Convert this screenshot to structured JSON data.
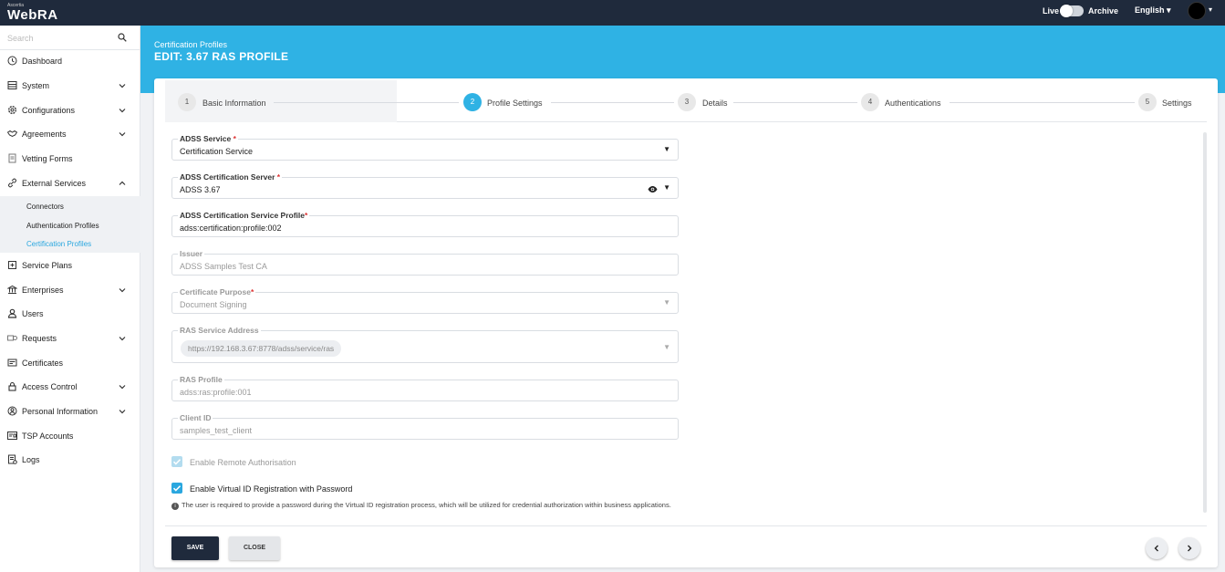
{
  "topbar": {
    "logo_small": "Ascertia",
    "logo_main": "WebRA",
    "live_label": "Live",
    "archive_label": "Archive",
    "language": "English ▾",
    "avatar_caret": "▾"
  },
  "sidebar": {
    "search_placeholder": "Search",
    "items": [
      {
        "label": "Dashboard",
        "icon": "clock-icon"
      },
      {
        "label": "System",
        "icon": "server-icon"
      },
      {
        "label": "Configurations",
        "icon": "gear-icon"
      },
      {
        "label": "Agreements",
        "icon": "handshake-icon"
      },
      {
        "label": "Vetting Forms",
        "icon": "form-icon"
      },
      {
        "label": "External Services",
        "icon": "link-icon"
      },
      {
        "label": "Service Plans",
        "icon": "plan-icon"
      },
      {
        "label": "Enterprises",
        "icon": "bank-icon"
      },
      {
        "label": "Users",
        "icon": "user-icon"
      },
      {
        "label": "Requests",
        "icon": "requests-icon"
      },
      {
        "label": "Certificates",
        "icon": "certificate-icon"
      },
      {
        "label": "Access Control",
        "icon": "lock-icon"
      },
      {
        "label": "Personal Information",
        "icon": "person-circle-icon"
      },
      {
        "label": "TSP Accounts",
        "icon": "id-card-icon"
      },
      {
        "label": "Logs",
        "icon": "logs-icon"
      }
    ],
    "sub_items": [
      {
        "label": "Connectors"
      },
      {
        "label": "Authentication Profiles"
      },
      {
        "label": "Certification Profiles"
      }
    ]
  },
  "header": {
    "breadcrumb": "Certification Profiles",
    "title": "EDIT: 3.67 RAS PROFILE"
  },
  "stepper": [
    {
      "num": "1",
      "label": "Basic Information"
    },
    {
      "num": "2",
      "label": "Profile Settings"
    },
    {
      "num": "3",
      "label": "Details"
    },
    {
      "num": "4",
      "label": "Authentications"
    },
    {
      "num": "5",
      "label": "Settings"
    }
  ],
  "form": {
    "adss_service": {
      "label": "ADSS Service",
      "req": "*",
      "value": "Certification Service"
    },
    "adss_server": {
      "label": "ADSS Certification Server",
      "req": "*",
      "value": "ADSS 3.67"
    },
    "service_profile": {
      "label": "ADSS Certification Service Profile",
      "req": "*",
      "value": "adss:certification:profile:002"
    },
    "issuer": {
      "label": "Issuer",
      "value": "ADSS Samples Test CA"
    },
    "purpose": {
      "label": "Certificate Purpose",
      "req": "*",
      "value": "Document Signing"
    },
    "ras_address": {
      "label": "RAS Service Address",
      "value": "https://192.168.3.67:8778/adss/service/ras"
    },
    "ras_profile": {
      "label": "RAS Profile",
      "value": "adss:ras:profile:001"
    },
    "client_id": {
      "label": "Client ID",
      "value": "samples_test_client"
    },
    "remote_auth": {
      "label": "Enable Remote Authorisation",
      "checked": true,
      "disabled": true
    },
    "virtual_id": {
      "label": "Enable Virtual ID Registration with Password",
      "checked": true
    },
    "note": "The user is required to provide a password during the Virtual ID registration process, which will be utilized for credential authorization within business applications."
  },
  "footer": {
    "save": "SAVE",
    "close": "CLOSE"
  },
  "colors": {
    "topbar": "#1f2a3c",
    "accent": "#2fb2e4",
    "active_link": "#2aa7df"
  }
}
